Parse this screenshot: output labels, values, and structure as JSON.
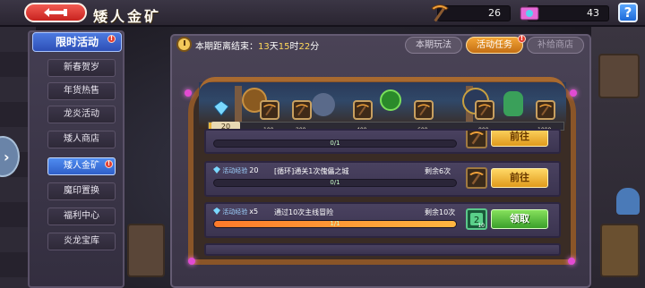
{
  "header": {
    "title": "矮人金矿",
    "resource_pickaxe": "26",
    "resource_ticket": "43",
    "help_label": "?"
  },
  "sidebar": {
    "section_title": "限时活动",
    "section_alert": "!",
    "items": [
      {
        "label": "新春贺岁"
      },
      {
        "label": "年货热售"
      },
      {
        "label": "龙炎活动"
      },
      {
        "label": "矮人商店"
      },
      {
        "label": "矮人金矿",
        "alert": "!"
      },
      {
        "label": "魔印置换"
      },
      {
        "label": "福利中心"
      },
      {
        "label": "炎龙宝库"
      }
    ]
  },
  "panel": {
    "countdown_label": "本期距离结束：",
    "countdown_days": "13",
    "countdown_days_unit": "天",
    "countdown_hours": "15",
    "countdown_hours_unit": "时",
    "countdown_mins": "22",
    "countdown_mins_unit": "分",
    "tabs": [
      {
        "label": "本期玩法"
      },
      {
        "label": "活动任务",
        "alert": "!"
      },
      {
        "label": "补给商店"
      }
    ]
  },
  "mine": {
    "start_value": "20",
    "milestones": [
      "100",
      "200",
      "400",
      "600",
      "800",
      "1000"
    ],
    "progress": 0.02
  },
  "tasks": [
    {
      "badge": "",
      "badge_value": "",
      "desc": "",
      "remain": "",
      "progress_text": "0/1",
      "progress": 0.0,
      "reward_count": "",
      "button": "前往",
      "button_type": "go"
    },
    {
      "badge": "活动经验",
      "badge_value": "20",
      "desc": "[循环]通关1次傀儡之城",
      "remain": "剩余6次",
      "progress_text": "0/1",
      "progress": 0.0,
      "reward_count": "",
      "button": "前往",
      "button_type": "go"
    },
    {
      "badge": "活动经验",
      "badge_value": "x5",
      "desc": "通过10次主线冒险",
      "remain": "剩余10次",
      "progress_text": "1/1",
      "progress": 1.0,
      "reward_count": "10",
      "button": "领取",
      "button_type": "claim"
    }
  ],
  "colors": {
    "accent_blue": "#2f5fc8",
    "go_button": "#e09a1c",
    "claim_button": "#3aa02a",
    "highlight_yellow": "#ffd85a",
    "alert_red": "#e23d2e"
  }
}
